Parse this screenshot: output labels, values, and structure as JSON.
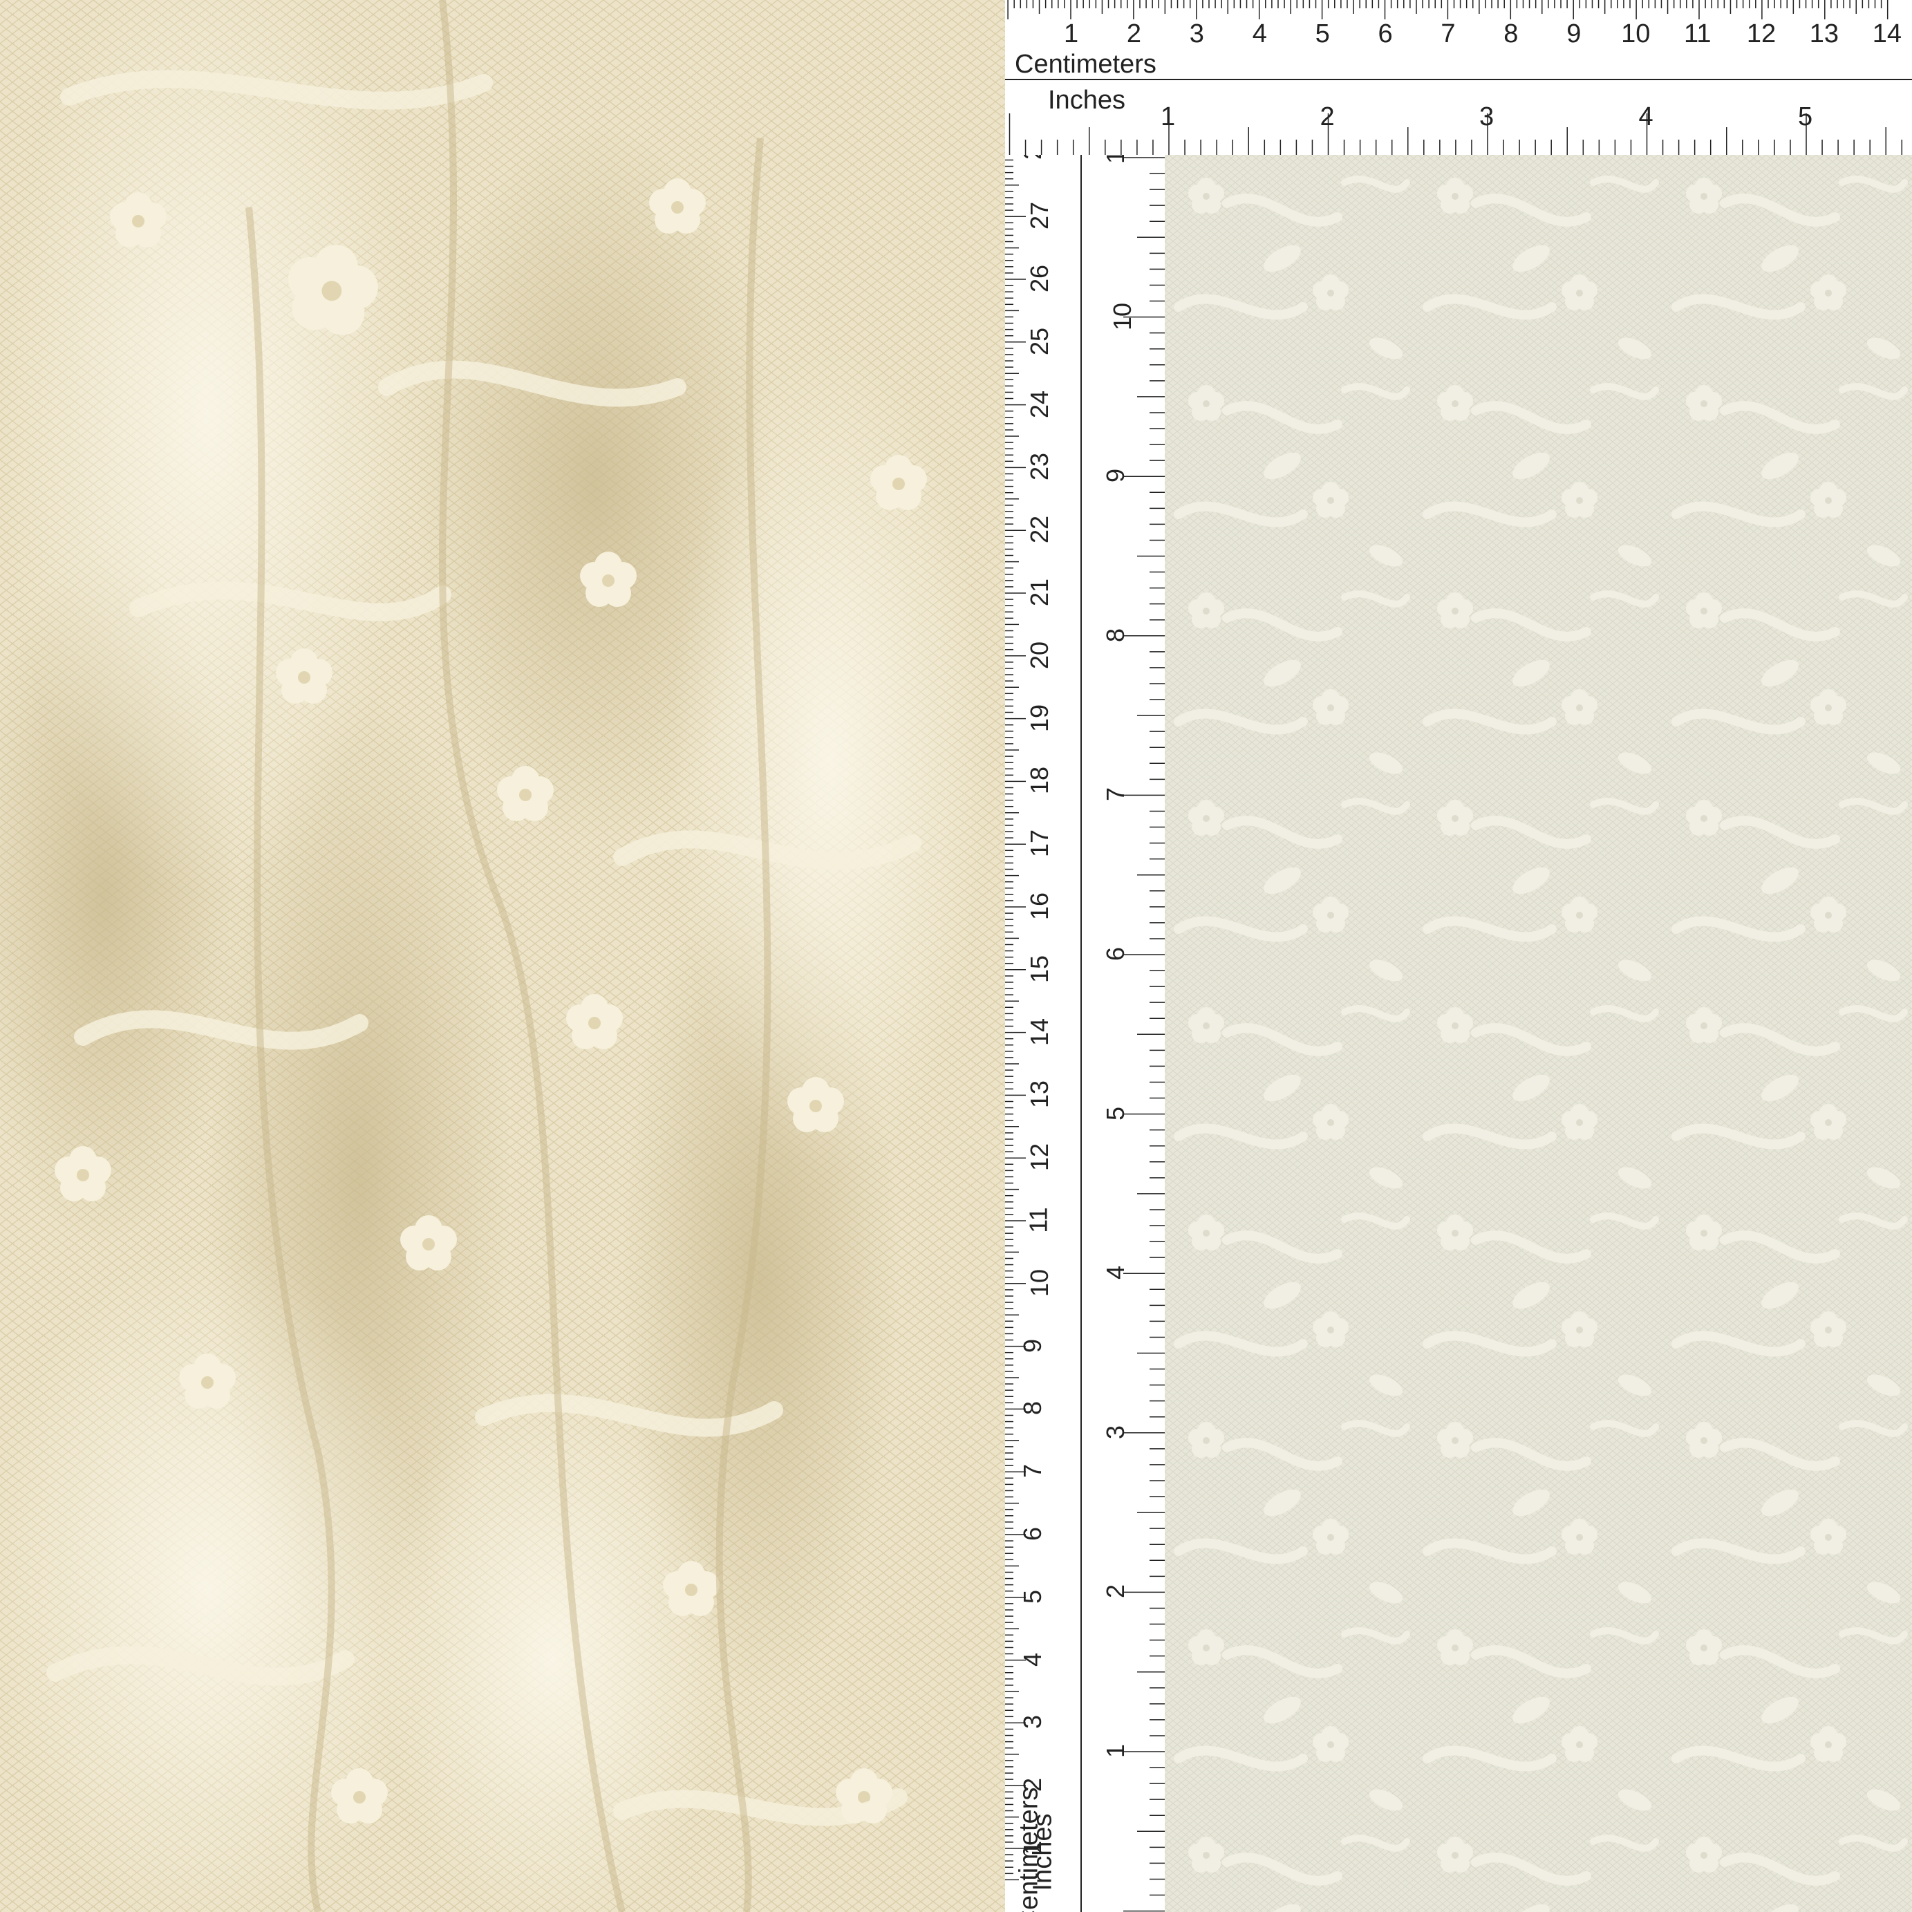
{
  "photo": {
    "left_label": "draped cream floral lace fabric",
    "right_label": "flat cream floral lace swatch"
  },
  "ruler_top": {
    "cm_label": "Centimeters",
    "in_label": "Inches",
    "cm_numbers": [
      "1",
      "2",
      "3",
      "4",
      "5",
      "6",
      "7",
      "8",
      "9",
      "10",
      "11",
      "12",
      "13",
      "14"
    ],
    "in_numbers": [
      "1",
      "2",
      "3",
      "4",
      "5"
    ]
  },
  "ruler_left": {
    "cm_label": "Centimeters",
    "in_label": "Inches",
    "cm_numbers": [
      "1",
      "2",
      "3",
      "4",
      "5",
      "6",
      "7",
      "8",
      "9",
      "10",
      "11",
      "12",
      "13",
      "14",
      "15",
      "16",
      "17",
      "18",
      "19",
      "20",
      "21",
      "22",
      "23",
      "24",
      "25",
      "26",
      "27",
      "2"
    ],
    "in_numbers": [
      "1",
      "2",
      "3",
      "4",
      "5",
      "6",
      "7",
      "8",
      "9",
      "10",
      "1"
    ]
  },
  "colors": {
    "lace_left": "#ece3c8",
    "lace_shadow": "#cfc19a",
    "lace_motif": "#f6f0dc",
    "swatch_bg": "#e7e6d9",
    "swatch_motif": "#f1efe3",
    "ruler_bg": "#ffffff",
    "ruler_ink": "#222222"
  }
}
